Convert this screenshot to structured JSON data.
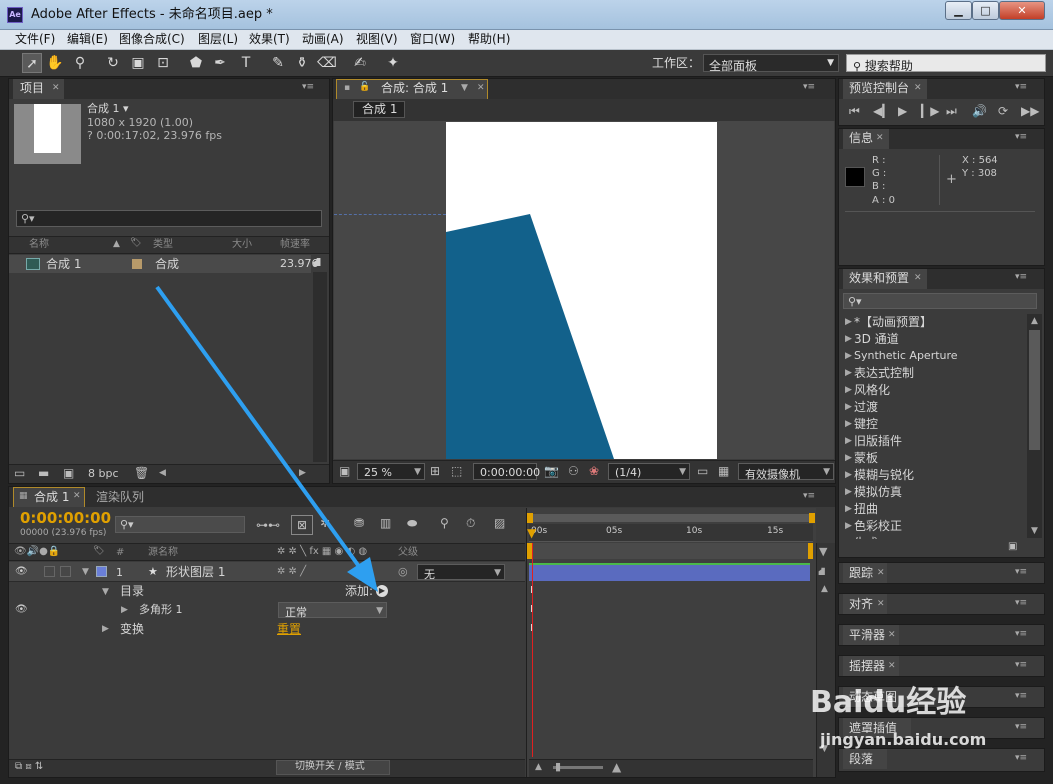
{
  "window": {
    "app_icon": "Ae",
    "title": "Adobe After Effects - 未命名项目.aep *",
    "min": "▁",
    "max": "□",
    "close": "✕"
  },
  "menu": [
    "文件(F)",
    "编辑(E)",
    "图像合成(C)",
    "图层(L)",
    "效果(T)",
    "动画(A)",
    "视图(V)",
    "窗口(W)",
    "帮助(H)"
  ],
  "toolbar": {
    "workspace_label": "工作区：",
    "workspace_value": "全部面板",
    "help_placeholder": "搜索帮助"
  },
  "project": {
    "tab": "项目",
    "comp_name": "合成 1 ▾",
    "comp_size": "1080 x 1920 (1.00)",
    "comp_duration": "? 0:00:17:02, 23.976 fps",
    "columns": [
      "名称",
      "类型",
      "大小",
      "帧速率"
    ],
    "items": [
      {
        "name": "合成 1",
        "type": "合成",
        "size": "",
        "fps": "23.976"
      }
    ],
    "bpc": "8 bpc"
  },
  "composition": {
    "tab": "合成: 合成 1",
    "sub_tab": "合成 1",
    "zoom": "25 %",
    "timecode": "0:00:00:00",
    "resolution": "(1/4)",
    "camera": "有效摄像机"
  },
  "preview": {
    "tab": "预览控制台"
  },
  "info": {
    "tab": "信息",
    "r": "R :",
    "g": "G :",
    "b": "B :",
    "a": "A : 0",
    "x": "X : 564",
    "y": "Y : 308"
  },
  "effects": {
    "tab": "效果和预置",
    "items": [
      "*【动画预置】",
      "3D 通道",
      "Synthetic Aperture",
      "表达式控制",
      "风格化",
      "过渡",
      "键控",
      "旧版插件",
      "蒙板",
      "模糊与锐化",
      "模拟仿真",
      "扭曲",
      "色彩校正",
      "生成"
    ]
  },
  "side_panels": [
    "跟踪",
    "对齐",
    "平滑器",
    "摇摆器",
    "动态草图",
    "遮罩插值",
    "段落"
  ],
  "timeline": {
    "tab": "合成 1",
    "render_tab": "渲染队列",
    "timecode": "0:00:00:00",
    "fps": "00000 (23.976 fps)",
    "col_num": "#",
    "col_name": "源名称",
    "col_parent": "父级",
    "layer_num": "1",
    "layer_name": "形状图层 1",
    "parent_value": "无",
    "contents": "目录",
    "add_label": "添加:",
    "polygon": "多角形 1",
    "blend": "正常",
    "transform": "变换",
    "reset": "重置",
    "ruler": [
      "00s",
      "05s",
      "10s",
      "15s"
    ],
    "footer_toggle": "切换开关 / 模式"
  },
  "watermark": {
    "brand": "Baidu经验",
    "url": "jingyan.baidu.com"
  },
  "colors": {
    "shape": "#12618b",
    "layer_label": "#6a7fd8",
    "timecode": "#e0a000",
    "arrow": "#2e9ff0",
    "duration_bar": "#5a6bbf"
  }
}
